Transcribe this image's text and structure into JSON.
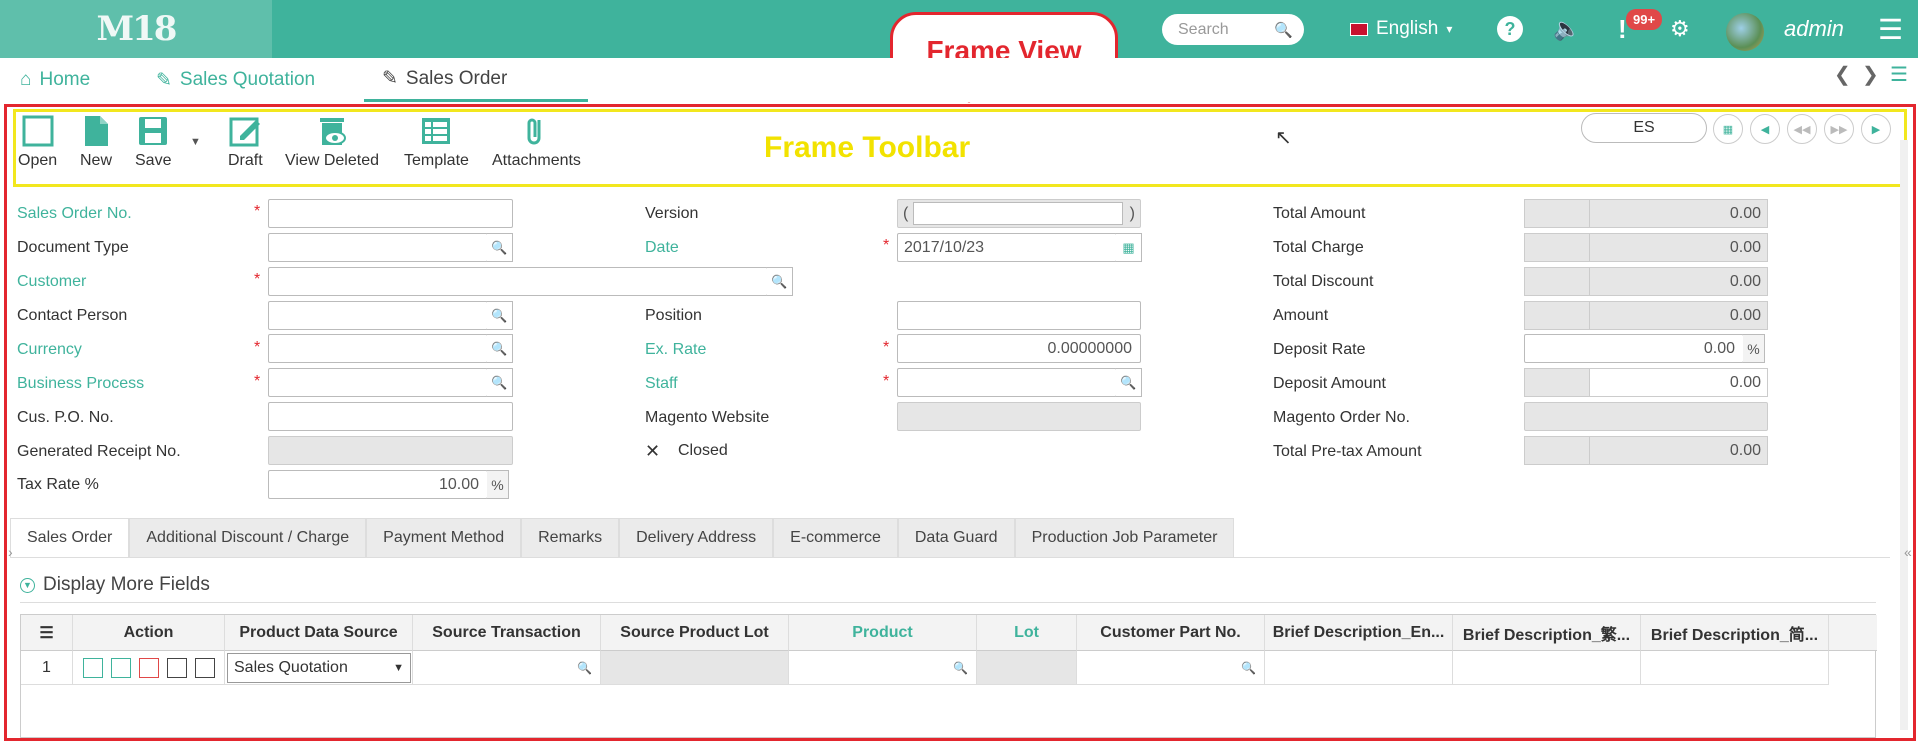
{
  "topbar": {
    "logo": "M18",
    "search_placeholder": "Search",
    "language": "English",
    "badge": "99+",
    "username": "admin"
  },
  "nav": {
    "tabs": [
      "Home",
      "Sales Quotation",
      "Sales Order"
    ]
  },
  "annotations": {
    "frame_view": "Frame View",
    "frame_toolbar": "Frame Toolbar"
  },
  "toolbar": {
    "open": "Open",
    "new": "New",
    "save": "Save",
    "draft": "Draft",
    "view_deleted": "View Deleted",
    "template": "Template",
    "attachments": "Attachments",
    "lang_code": "ES"
  },
  "form": {
    "col1": {
      "sales_order_no": "Sales Order No.",
      "document_type": "Document Type",
      "customer": "Customer",
      "contact_person": "Contact Person",
      "currency": "Currency",
      "business_process": "Business Process",
      "cus_po_no": "Cus. P.O. No.",
      "generated_receipt_no": "Generated Receipt No.",
      "tax_rate": "Tax Rate %",
      "tax_rate_value": "10.00",
      "percent": "%"
    },
    "col2": {
      "version": "Version",
      "version_open": "(",
      "version_close": ")",
      "date": "Date",
      "date_value": "2017/10/23",
      "position": "Position",
      "ex_rate": "Ex. Rate",
      "ex_rate_value": "0.00000000",
      "staff": "Staff",
      "magento_website": "Magento Website",
      "closed": "Closed"
    },
    "col3": {
      "total_amount": "Total Amount",
      "total_amount_value": "0.00",
      "total_charge": "Total Charge",
      "total_charge_value": "0.00",
      "total_discount": "Total Discount",
      "total_discount_value": "0.00",
      "amount": "Amount",
      "amount_value": "0.00",
      "deposit_rate": "Deposit Rate",
      "deposit_rate_value": "0.00",
      "deposit_amount": "Deposit Amount",
      "deposit_amount_value": "0.00",
      "magento_order_no": "Magento Order No.",
      "total_pretax_amount": "Total Pre-tax Amount",
      "total_pretax_amount_value": "0.00"
    }
  },
  "subtabs": [
    "Sales Order",
    "Additional Discount / Charge",
    "Payment Method",
    "Remarks",
    "Delivery Address",
    "E-commerce",
    "Data Guard",
    "Production Job Parameter"
  ],
  "display_more": "Display More Fields",
  "grid": {
    "headers": {
      "action": "Action",
      "product_data_source": "Product Data Source",
      "source_transaction": "Source Transaction",
      "source_product_lot": "Source Product Lot",
      "product": "Product",
      "lot": "Lot",
      "customer_part_no": "Customer Part No.",
      "brief_en": "Brief Description_En...",
      "brief_tc": "Brief Description_繁...",
      "brief_sc": "Brief Description_简..."
    },
    "row": {
      "index": "1",
      "product_data_source": "Sales Quotation"
    }
  },
  "colors": {
    "brand": "#3fb39c",
    "annotation_red": "#e3262e",
    "annotation_yellow": "#f2e71e"
  }
}
